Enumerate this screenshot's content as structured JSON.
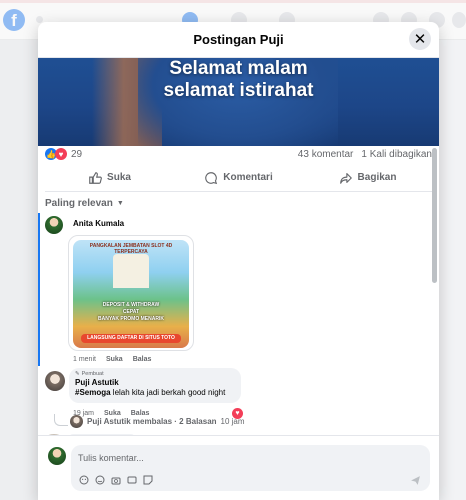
{
  "modal": {
    "title": "Postingan Puji",
    "close_icon": "close-icon"
  },
  "post": {
    "image_text_line1": "Selamat malam",
    "image_text_line2": "selamat istirahat",
    "reaction_count": "29",
    "comment_count": "43 komentar",
    "share_count": "1 Kali dibagikan",
    "actions": {
      "like": "Suka",
      "comment": "Komentari",
      "share": "Bagikan"
    }
  },
  "sort": {
    "label": "Paling relevan"
  },
  "comments": [
    {
      "author": "Anita Kumala",
      "sticker": {
        "title": "PANGKALAN JEMBATAN SLOT 4D TERPERCAYA",
        "middle_line1": "DEPOSIT & WITHDRAW",
        "middle_line2": "CEPAT",
        "middle_line3": "BANYAK PROMO MENARIK",
        "bottom": "LANGSUNG DAFTAR DI SITUS TOTO"
      },
      "time": "1 menit",
      "like": "Suka",
      "reply": "Balas"
    },
    {
      "badge": "Pembuat",
      "author": "Puji Astutik",
      "hashtag": "#Semoga",
      "text": " lelah kita jadi berkah good night",
      "time": "19 jam",
      "like": "Suka",
      "reply": "Balas",
      "replies_summary": "Puji Astutik membalas · 2 Balasan",
      "replies_time": "10 jam"
    }
  ],
  "composer": {
    "placeholder": "Tulis komentar..."
  },
  "colors": {
    "brand": "#1877f2",
    "love": "#f33e58",
    "post_bg": "#1d4688"
  }
}
